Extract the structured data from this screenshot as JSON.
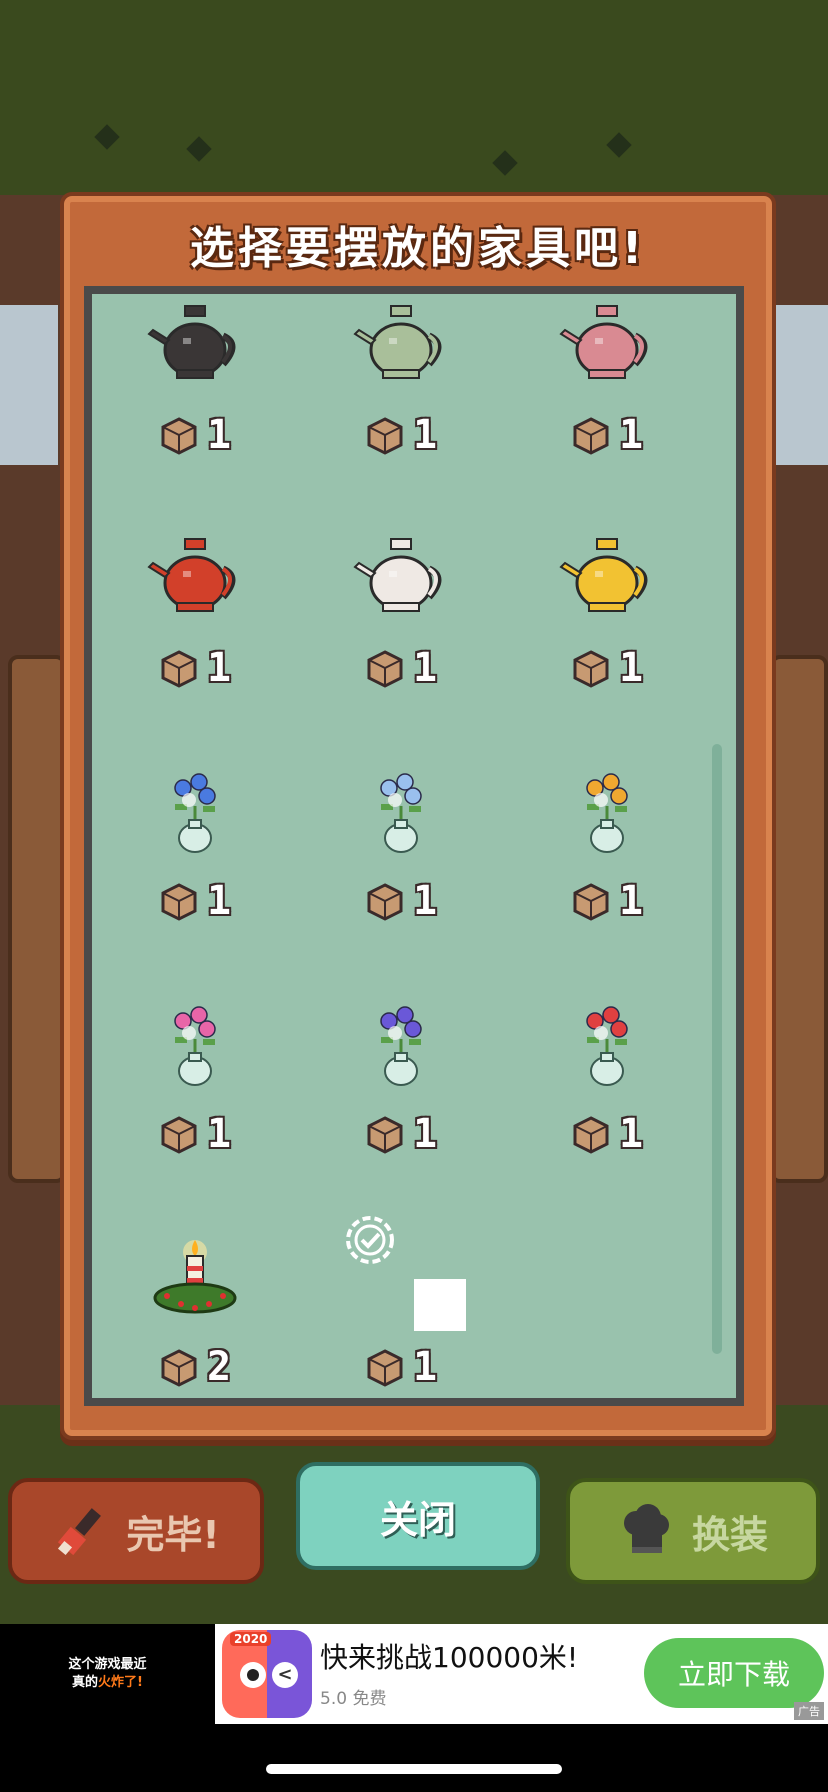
{
  "dialog": {
    "title": "选择要摆放的家具吧!"
  },
  "items": [
    {
      "kind": "teapot",
      "color": "#3a3636",
      "qty": "1"
    },
    {
      "kind": "teapot",
      "color": "#a9bf9a",
      "qty": "1"
    },
    {
      "kind": "teapot",
      "color": "#d98a92",
      "qty": "1"
    },
    {
      "kind": "teapot",
      "color": "#d2402a",
      "qty": "1"
    },
    {
      "kind": "teapot",
      "color": "#efe9e4",
      "qty": "1"
    },
    {
      "kind": "teapot",
      "color": "#f2c232",
      "qty": "1"
    },
    {
      "kind": "flower-vase",
      "color": "#4a7ae0",
      "qty": "1"
    },
    {
      "kind": "flower-vase",
      "color": "#9ac0ee",
      "qty": "1"
    },
    {
      "kind": "flower-vase",
      "color": "#f0a830",
      "qty": "1"
    },
    {
      "kind": "flower-vase",
      "color": "#e865a8",
      "qty": "1"
    },
    {
      "kind": "flower-vase",
      "color": "#6a58d8",
      "qty": "1"
    },
    {
      "kind": "flower-vase",
      "color": "#e04040",
      "qty": "1"
    },
    {
      "kind": "candle-wreath",
      "color": "#3e7a2a",
      "qty": "2"
    },
    {
      "kind": "placeholder",
      "color": "#ffffff",
      "qty": "1"
    }
  ],
  "buttons": {
    "done_label": "完毕!",
    "close_label": "关闭",
    "dress_label": "换装"
  },
  "ad": {
    "left_line1": "这个游戏最近",
    "left_line2_prefix": "真的",
    "left_line2_hot": "火炸了!",
    "app_badge": "2020",
    "title": "快来挑战100000米!",
    "rating": "5.0 免费",
    "cta": "立即下载",
    "mark": "广告"
  },
  "colors": {
    "panel_bg": "#99c2ad",
    "frame": "#c2693a",
    "close_button": "#7ed2bf"
  }
}
